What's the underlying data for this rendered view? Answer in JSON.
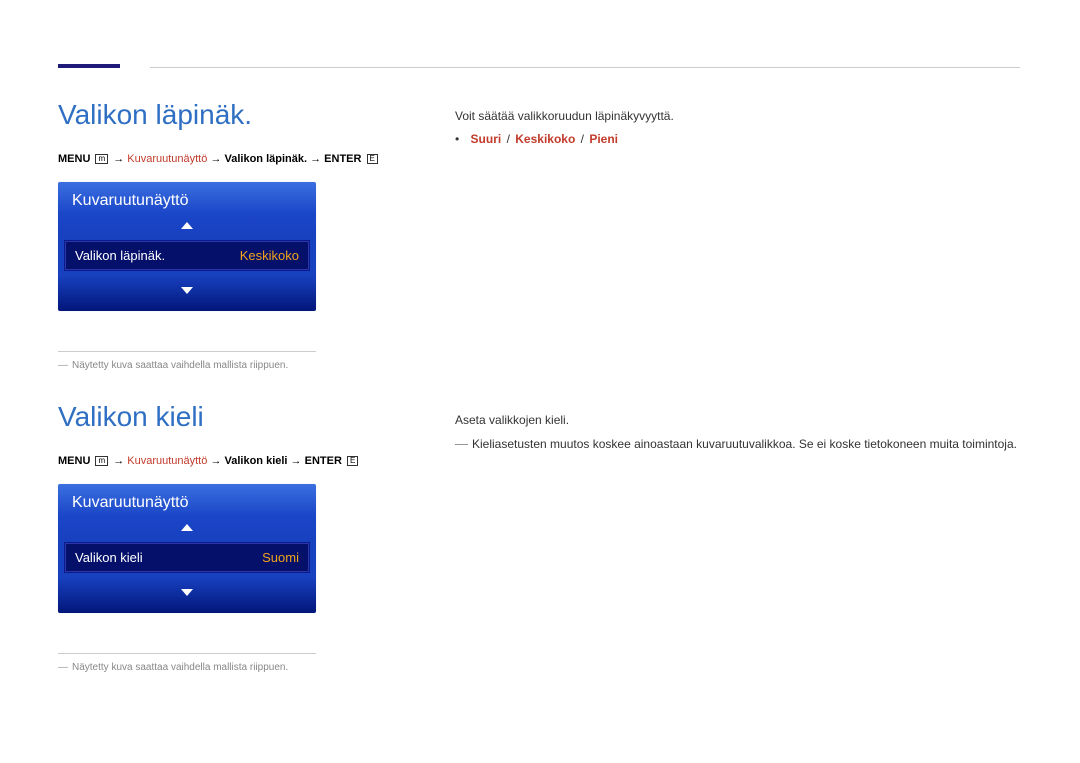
{
  "section1": {
    "title": "Valikon läpinäk.",
    "breadcrumb": {
      "menu": "MENU",
      "path1": "Kuvaruutunäyttö",
      "path2": "Valikon läpinäk.",
      "enter": "ENTER"
    },
    "widget": {
      "header": "Kuvaruutunäyttö",
      "item_label": "Valikon läpinäk.",
      "item_value": "Keskikoko"
    },
    "footnote": "Näytetty kuva saattaa vaihdella mallista riippuen.",
    "body": "Voit säätää valikkoruudun läpinäkyvyyttä.",
    "options": {
      "a": "Suuri",
      "b": "Keskikoko",
      "c": "Pieni"
    }
  },
  "section2": {
    "title": "Valikon kieli",
    "breadcrumb": {
      "menu": "MENU",
      "path1": "Kuvaruutunäyttö",
      "path2": "Valikon kieli",
      "enter": "ENTER"
    },
    "widget": {
      "header": "Kuvaruutunäyttö",
      "item_label": "Valikon kieli",
      "item_value": "Suomi"
    },
    "footnote": "Näytetty kuva saattaa vaihdella mallista riippuen.",
    "body": "Aseta valikkojen kieli.",
    "note": "Kieliasetusten muutos koskee ainoastaan kuvaruutuvalikkoa. Se ei koske tietokoneen muita toimintoja."
  }
}
